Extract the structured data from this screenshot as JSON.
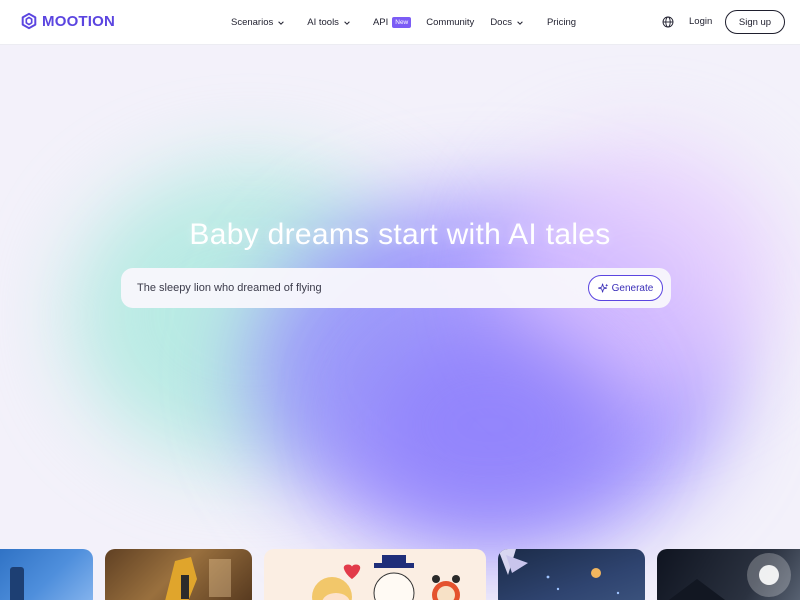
{
  "header": {
    "logo_text": "MOOTION",
    "nav": [
      {
        "label": "Scenarios",
        "has_dropdown": true
      },
      {
        "label": "AI tools",
        "has_dropdown": true
      },
      {
        "label": "API",
        "badge": "New"
      },
      {
        "label": "Community"
      },
      {
        "label": "Docs",
        "has_dropdown": true
      },
      {
        "label": "Pricing"
      }
    ],
    "language_icon": "globe-icon",
    "login_label": "Login",
    "signup_label": "Sign up"
  },
  "hero": {
    "title": "Baby dreams start with AI tales",
    "prompt_value": "The sleepy lion who dreamed of flying",
    "generate_label": "Generate",
    "generate_icon": "sparkle-icon"
  },
  "colors": {
    "brand": "#5b45e0",
    "badge": "#7b5cf5",
    "background": "#f3f1fa"
  }
}
